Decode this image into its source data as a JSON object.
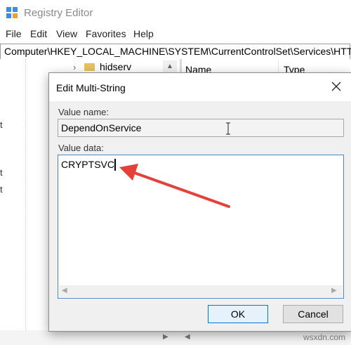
{
  "window": {
    "title": "Registry Editor",
    "menu": [
      "File",
      "Edit",
      "View",
      "Favorites",
      "Help"
    ],
    "address": "Computer\\HKEY_LOCAL_MACHINE\\SYSTEM\\CurrentControlSet\\Services\\HTTP"
  },
  "tree": {
    "visible_item": "hidserv",
    "expander": "›"
  },
  "list": {
    "columns": [
      "Name",
      "Type"
    ]
  },
  "dialog": {
    "title": "Edit Multi-String",
    "value_name_label": "Value name:",
    "value_name": "DependOnService",
    "value_data_label": "Value data:",
    "value_data": "CRYPTSVC",
    "ok_label": "OK",
    "cancel_label": "Cancel"
  },
  "annotation": {
    "arrow_color": "#e5413b"
  },
  "watermark": "wsxdn.com"
}
